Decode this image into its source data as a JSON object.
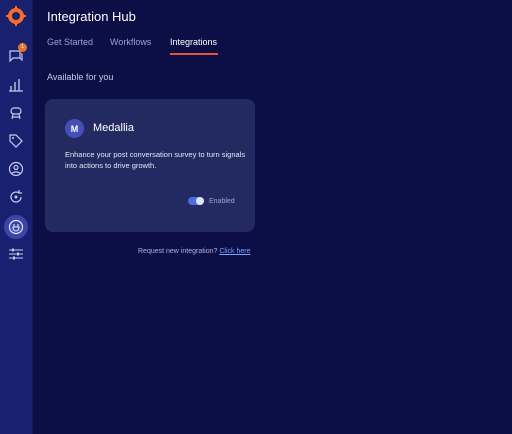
{
  "app": {
    "title": "Integration Hub"
  },
  "sidebar": {
    "badge_count": "1",
    "items": [
      {
        "name": "conversations",
        "icon": "chat-icon"
      },
      {
        "name": "analytics",
        "icon": "bar-chart-icon"
      },
      {
        "name": "bots",
        "icon": "robot-icon"
      },
      {
        "name": "tags",
        "icon": "tag-icon"
      },
      {
        "name": "contacts",
        "icon": "user-circle-icon"
      },
      {
        "name": "automation",
        "icon": "cycle-icon"
      },
      {
        "name": "integrations",
        "icon": "plug-icon",
        "active": true
      },
      {
        "name": "settings",
        "icon": "sliders-icon"
      }
    ]
  },
  "tabs": [
    {
      "label": "Get Started"
    },
    {
      "label": "Workflows"
    },
    {
      "label": "Integrations",
      "active": true
    }
  ],
  "section": {
    "label": "Available for you"
  },
  "card": {
    "logo_letter": "M",
    "title": "Medallia",
    "description": "Enhance your post conversation survey to turn signals into actions to drive growth.",
    "toggle_label": "Enabled",
    "enabled": true
  },
  "footer": {
    "request_text": "Request new integration?",
    "link_text": "Click here"
  },
  "colors": {
    "background": "#0b0f45",
    "sidebar": "#1a2070",
    "card": "#232a62",
    "accent": "#e8523a",
    "toggle": "#4a6fe0",
    "badge": "#f0702a"
  }
}
